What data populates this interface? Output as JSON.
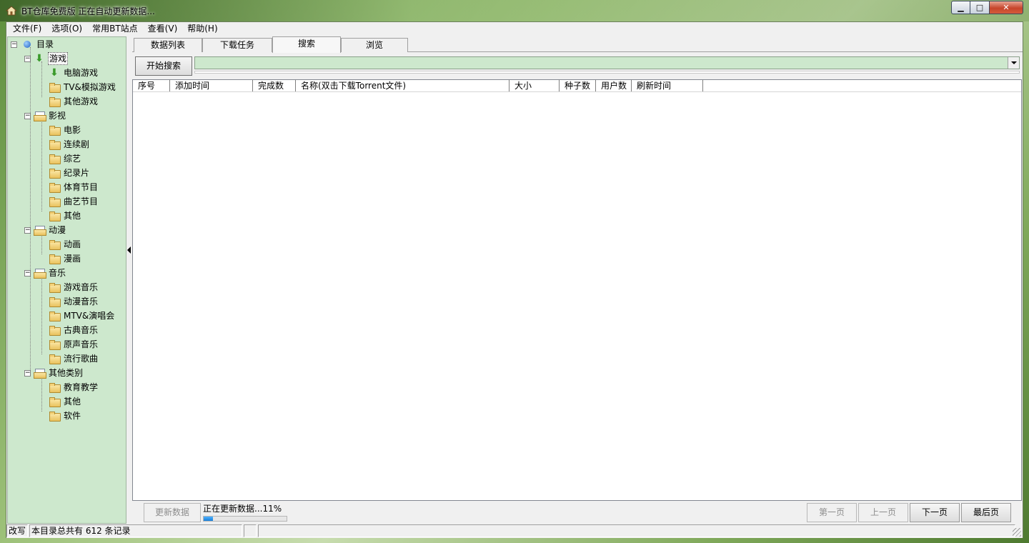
{
  "window": {
    "title": "BT仓库免费版 正在自动更新数据...",
    "minimize": "▁",
    "maximize": "□",
    "close": "✕"
  },
  "menu": [
    "文件(F)",
    "选项(O)",
    "常用BT站点",
    "查看(V)",
    "帮助(H)"
  ],
  "tree": {
    "root": "目录",
    "categories": [
      {
        "label": "游戏",
        "selected": true,
        "children": [
          "电脑游戏",
          "TV&模拟游戏",
          "其他游戏"
        ]
      },
      {
        "label": "影视",
        "children": [
          "电影",
          "连续剧",
          "综艺",
          "纪录片",
          "体育节目",
          "曲艺节目",
          "其他"
        ]
      },
      {
        "label": "动漫",
        "children": [
          "动画",
          "漫画"
        ]
      },
      {
        "label": "音乐",
        "children": [
          "游戏音乐",
          "动漫音乐",
          "MTV&演唱会",
          "古典音乐",
          "原声音乐",
          "流行歌曲"
        ]
      },
      {
        "label": "其他类别",
        "children": [
          "教育教学",
          "其他",
          "软件"
        ]
      }
    ]
  },
  "tabs": [
    "数据列表",
    "下载任务",
    "搜索",
    "浏览"
  ],
  "active_tab": "搜索",
  "search": {
    "button": "开始搜索",
    "value": ""
  },
  "columns": [
    "序号",
    "添加时间",
    "完成数",
    "名称(双击下载Torrent文件)",
    "大小",
    "种子数",
    "用户数",
    "刷新时间"
  ],
  "footer": {
    "update_button": "更新数据",
    "status": "正在更新数据...11%",
    "progress_percent": 11,
    "first_page": "第一页",
    "prev_page": "上一页",
    "next_page": "下一页",
    "last_page": "最后页"
  },
  "statusbar": {
    "mode": "改写",
    "record_info": "本目录总共有 612 条记录",
    "cell3": "",
    "cell4": ""
  },
  "colors": {
    "sidebar_bg": "#cde8cd",
    "search_bg": "#cde8cd",
    "progress": "#1a7fd8"
  }
}
